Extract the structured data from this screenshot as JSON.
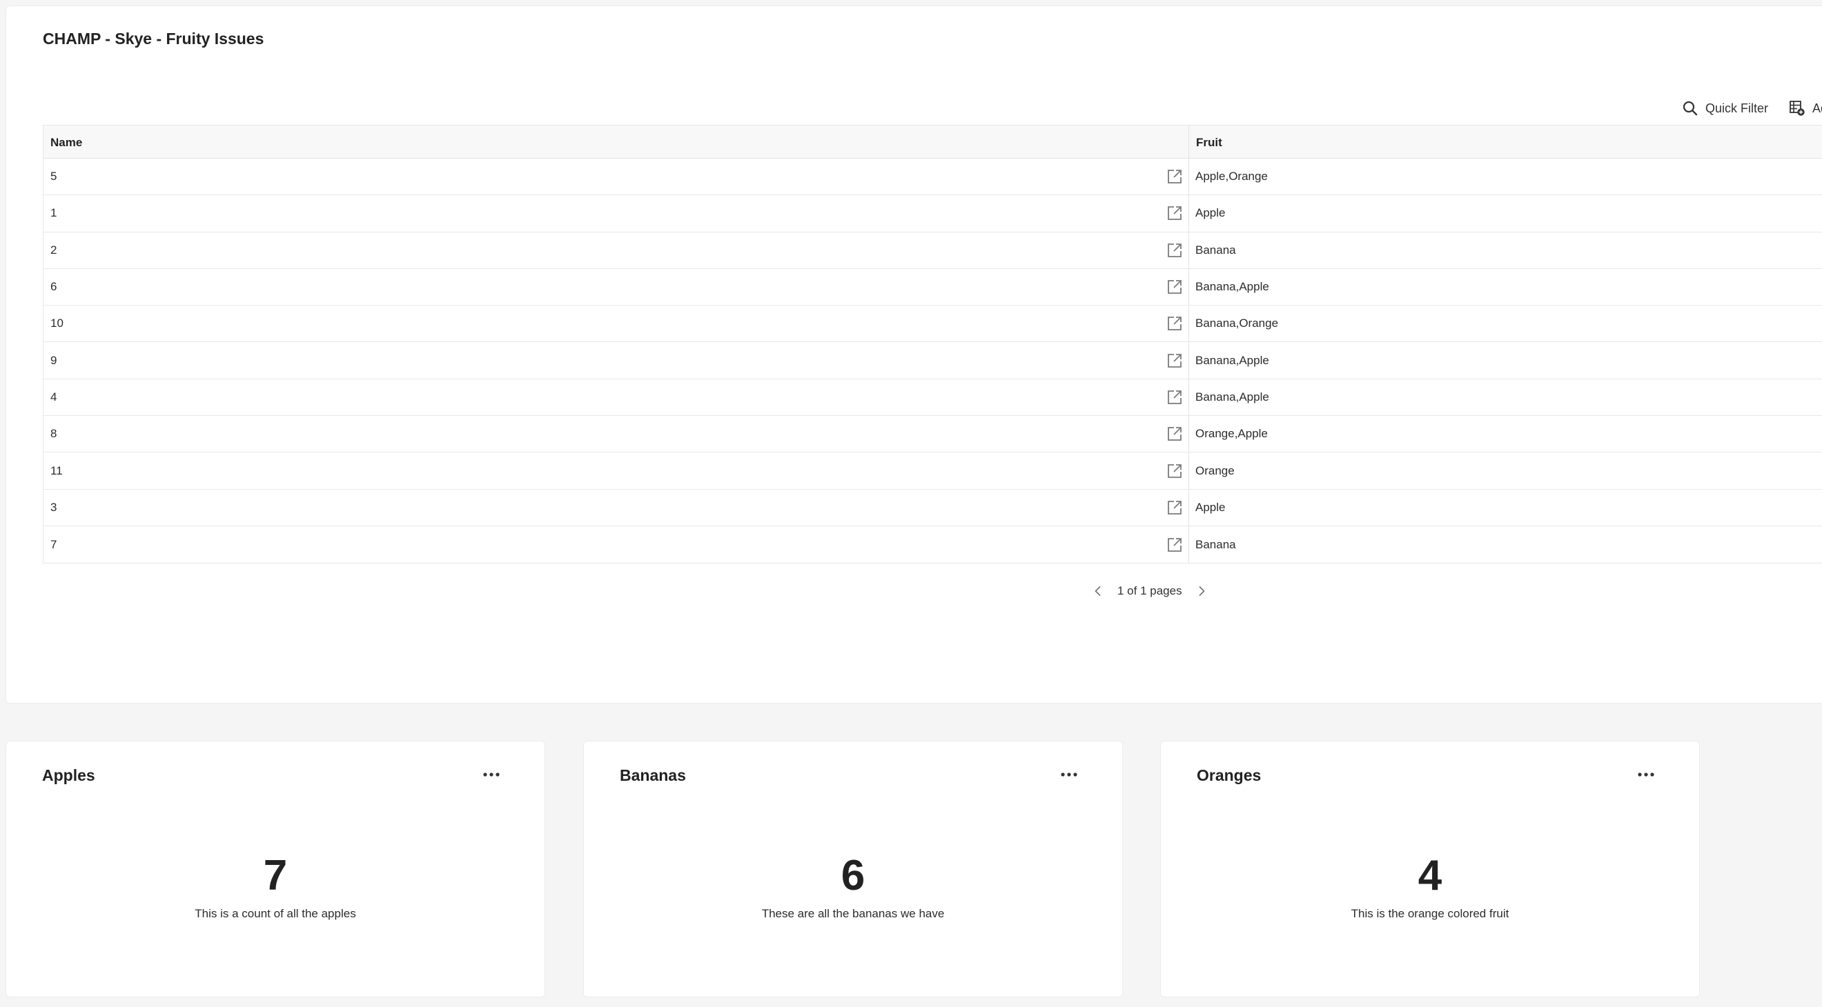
{
  "table_panel": {
    "title": "CHAMP - Skye - Fruity Issues",
    "toolbar": {
      "quick_filter": "Quick Filter",
      "add_label": "Add"
    },
    "columns": {
      "name": "Name",
      "fruit": "Fruit"
    },
    "rows": [
      {
        "name": "5",
        "fruit": "Apple,Orange"
      },
      {
        "name": "1",
        "fruit": "Apple"
      },
      {
        "name": "2",
        "fruit": "Banana"
      },
      {
        "name": "6",
        "fruit": "Banana,Apple"
      },
      {
        "name": "10",
        "fruit": "Banana,Orange"
      },
      {
        "name": "9",
        "fruit": "Banana,Apple"
      },
      {
        "name": "4",
        "fruit": "Banana,Apple"
      },
      {
        "name": "8",
        "fruit": "Orange,Apple"
      },
      {
        "name": "11",
        "fruit": "Orange"
      },
      {
        "name": "3",
        "fruit": "Apple"
      },
      {
        "name": "7",
        "fruit": "Banana"
      }
    ],
    "pagination": "1 of 1 pages"
  },
  "cards": [
    {
      "title": "Apples",
      "value": "7",
      "description": "This is a count of all the apples"
    },
    {
      "title": "Bananas",
      "value": "6",
      "description": "These are all the bananas we have"
    },
    {
      "title": "Oranges",
      "value": "4",
      "description": "This is the orange colored fruit"
    }
  ],
  "icons": {
    "search": "search-icon",
    "add_column": "add-column-icon",
    "open_link": "open-external-icon",
    "prev": "chevron-left-icon",
    "next": "chevron-right-icon",
    "more": "more-horizontal-icon"
  }
}
